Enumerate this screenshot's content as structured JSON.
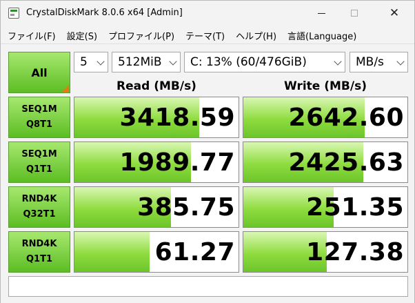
{
  "window": {
    "title": "CrystalDiskMark 8.0.6 x64 [Admin]"
  },
  "menu": {
    "items": [
      "ファイル(F)",
      "設定(S)",
      "プロファイル(P)",
      "テーマ(T)",
      "ヘルプ(H)",
      "言語(Language)"
    ]
  },
  "controls": {
    "all_label": "All",
    "count": "5",
    "size": "512MiB",
    "drive": "C: 13% (60/476GiB)",
    "unit": "MB/s"
  },
  "headers": {
    "read": "Read (MB/s)",
    "write": "Write (MB/s)"
  },
  "rows": [
    {
      "line1": "SEQ1M",
      "line2": "Q8T1",
      "read": "3418.59",
      "write": "2642.60",
      "read_fill": 0.76,
      "write_fill": 0.74
    },
    {
      "line1": "SEQ1M",
      "line2": "Q1T1",
      "read": "1989.77",
      "write": "2425.63",
      "read_fill": 0.71,
      "write_fill": 0.73
    },
    {
      "line1": "RND4K",
      "line2": "Q32T1",
      "read": "385.75",
      "write": "251.35",
      "read_fill": 0.59,
      "write_fill": 0.55
    },
    {
      "line1": "RND4K",
      "line2": "Q1T1",
      "read": "61.27",
      "write": "127.38",
      "read_fill": 0.46,
      "write_fill": 0.51
    }
  ],
  "comment": ""
}
